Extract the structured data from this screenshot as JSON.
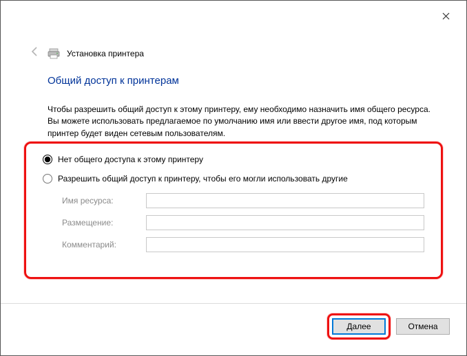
{
  "header": {
    "wizard_title": "Установка принтера"
  },
  "heading": "Общий доступ к принтерам",
  "description": "Чтобы разрешить общий доступ к этому принтеру, ему необходимо назначить имя общего ресурса. Вы можете использовать предлагаемое по умолчанию имя или ввести другое имя, под которым принтер будет виден сетевым пользователям.",
  "options": {
    "no_share_label": "Нет общего доступа к этому принтеру",
    "share_label": "Разрешить общий доступ к принтеру, чтобы его могли использовать другие",
    "selected": "no_share",
    "fields": {
      "share_name_label": "Имя ресурса:",
      "share_name_value": "",
      "location_label": "Размещение:",
      "location_value": "",
      "comment_label": "Комментарий:",
      "comment_value": ""
    }
  },
  "buttons": {
    "next": "Далее",
    "cancel": "Отмена"
  }
}
